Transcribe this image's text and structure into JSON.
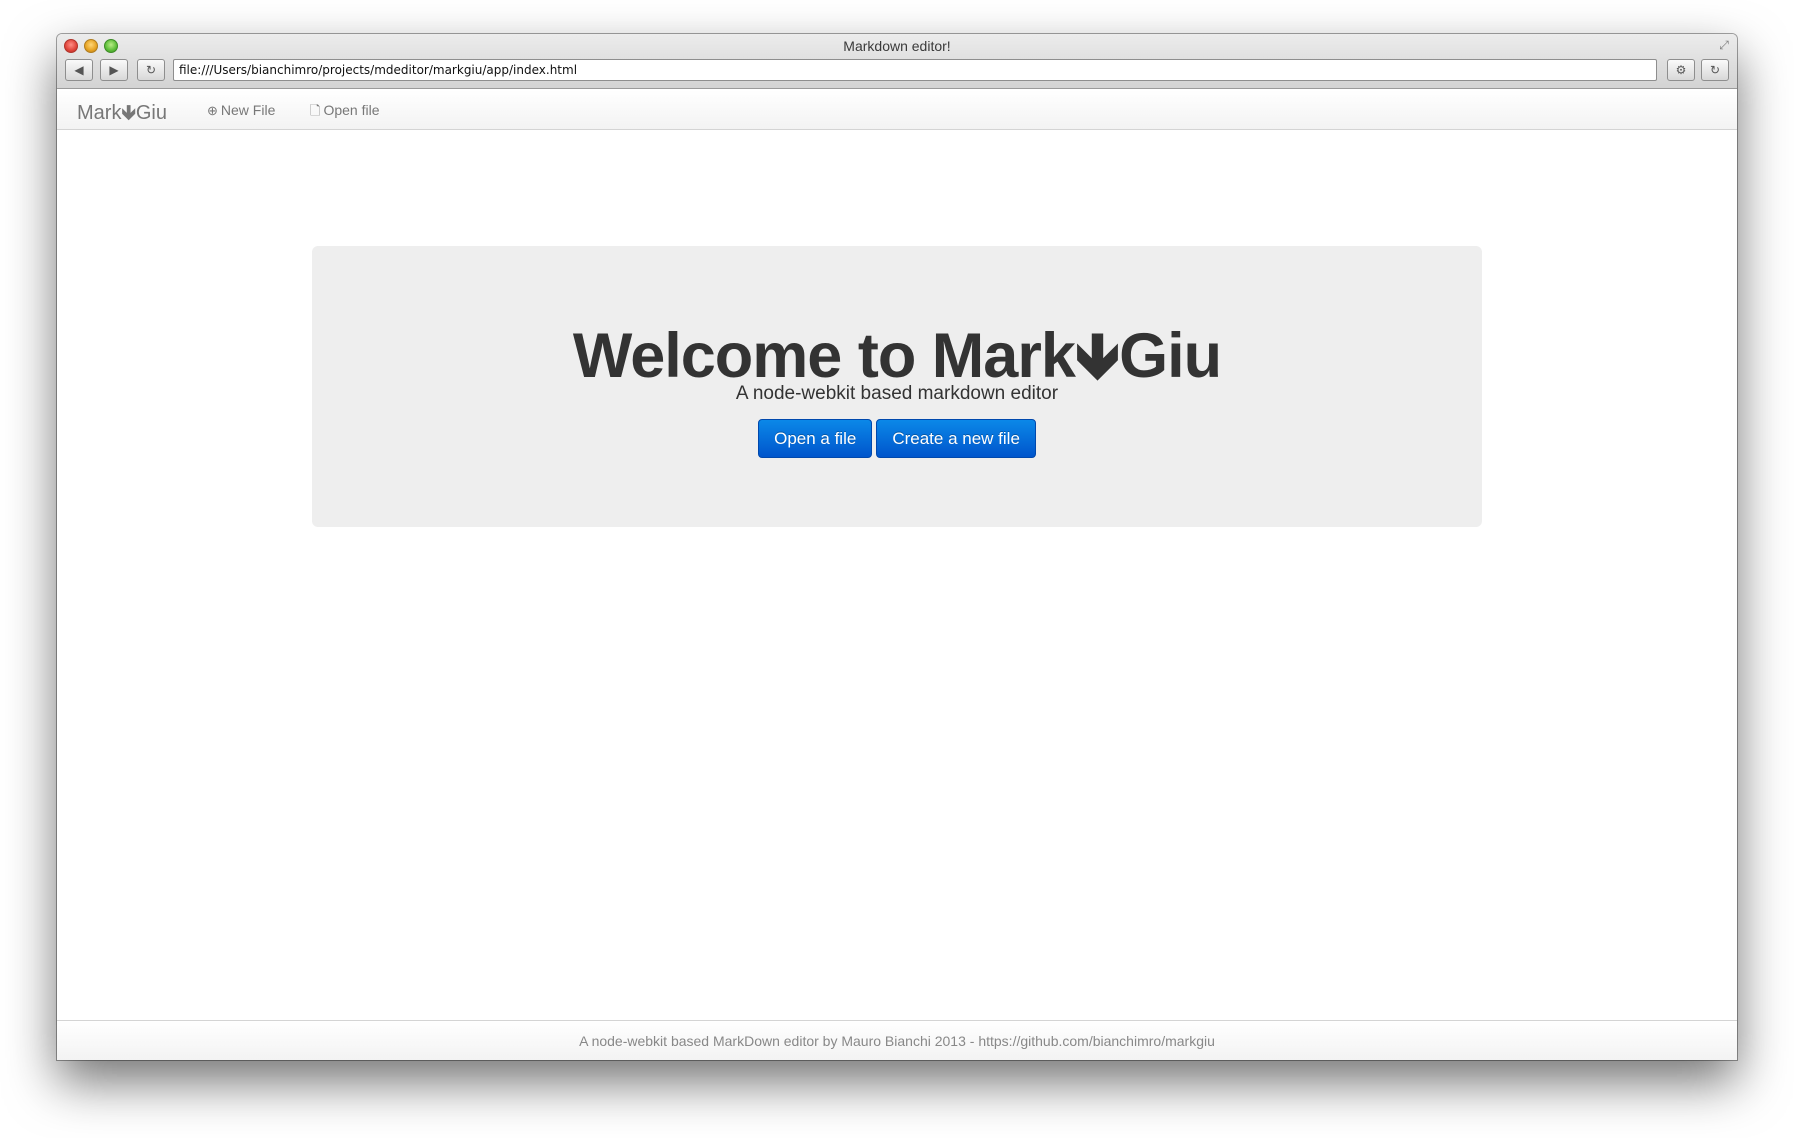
{
  "window": {
    "title": "Markdown editor!",
    "url": "file:///Users/bianchimro/projects/mdeditor/markgiu/app/index.html"
  },
  "toolbar": {
    "back_icon": "◀",
    "forward_icon": "▶",
    "reload_icon": "↻",
    "settings_icon": "⚙",
    "reload2_icon": "↻",
    "fullscreen_icon": "⤢"
  },
  "navbar": {
    "brand_pre": "Mark",
    "brand_arrow": "🡻",
    "brand_post": "Giu",
    "new_file_icon": "⊕",
    "new_file_label": "New File",
    "open_file_icon": "🗋",
    "open_file_label": "Open file"
  },
  "hero": {
    "title_pre": "Welcome to Mark",
    "title_arrow": "🡻",
    "title_post": "Giu",
    "lead": "A node-webkit based markdown editor",
    "open_button": "Open a file",
    "create_button": "Create a new file"
  },
  "footer": {
    "text": "A node-webkit based MarkDown editor by Mauro Bianchi 2013 - https://github.com/bianchimro/markgiu"
  },
  "colors": {
    "primary_button": "#0055cc",
    "hero_background": "#eeeeee",
    "text": "#333333"
  }
}
